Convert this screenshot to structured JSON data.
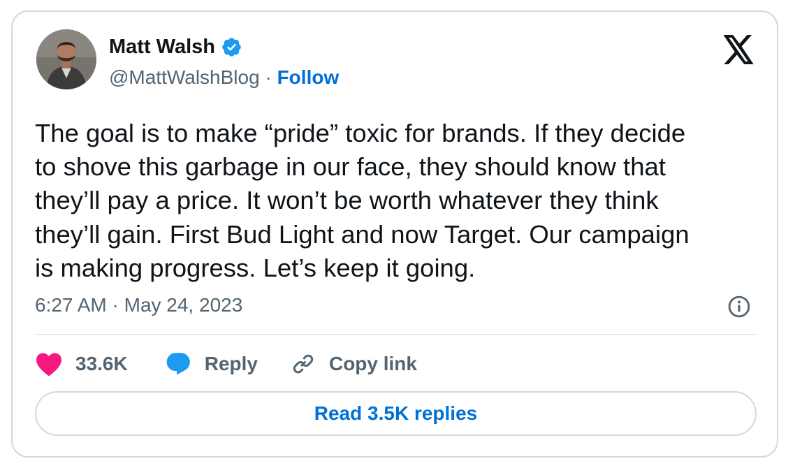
{
  "author": {
    "name": "Matt Walsh",
    "handle": "@MattWalshBlog",
    "separator": " · ",
    "follow_label": "Follow",
    "verified": true
  },
  "tweet": {
    "text": "The goal is to make “pride” toxic for brands. If they decide\nto shove this garbage in our face, they should know that\nthey’ll pay a price. It won’t be worth whatever they think\nthey’ll gain. First Bud Light and now Target. Our campaign\nis making progress. Let’s keep it going.",
    "timestamp": "6:27 AM · May 24, 2023"
  },
  "actions": {
    "like_count": "33.6K",
    "reply_label": "Reply",
    "copy_link_label": "Copy link"
  },
  "read_replies_label": "Read 3.5K replies",
  "icons": {
    "brand": "x-logo-icon",
    "verified": "verified-badge-icon",
    "info": "info-icon",
    "like": "heart-icon",
    "reply": "speech-bubble-icon",
    "copy": "link-icon"
  },
  "colors": {
    "link_blue": "#006fd6",
    "verified_blue": "#1d9bf0",
    "heart_pink": "#f91880",
    "muted_text": "#536471",
    "border": "#cfd9de"
  }
}
